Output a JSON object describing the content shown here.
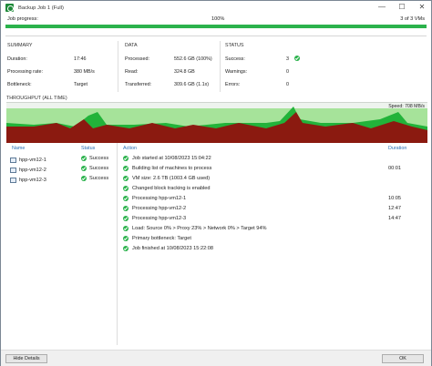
{
  "window": {
    "title": "Backup Job 1 (Full)",
    "controls": [
      "—",
      "☐",
      "✕"
    ]
  },
  "progress": {
    "label": "Job progress:",
    "percent_text": "100%",
    "count_text": "3 of 3 VMs",
    "fraction": 1.0,
    "color": "#2bb24c"
  },
  "summary": {
    "heading": "SUMMARY",
    "rows": [
      {
        "label": "Duration:",
        "value": "17:46"
      },
      {
        "label": "Processing rate:",
        "value": "380 MB/s"
      },
      {
        "label": "Bottleneck:",
        "value": "Target"
      }
    ]
  },
  "data": {
    "heading": "DATA",
    "rows": [
      {
        "label": "Processed:",
        "value": "552.6 GB (100%)"
      },
      {
        "label": "Read:",
        "value": "324.8 GB"
      },
      {
        "label": "Transferred:",
        "value": "309.6 GB (1.1x)"
      }
    ]
  },
  "status": {
    "heading": "STATUS",
    "rows": [
      {
        "label": "Success:",
        "value": "3"
      },
      {
        "label": "Warnings:",
        "value": "0"
      },
      {
        "label": "Errors:",
        "value": "0"
      }
    ]
  },
  "throughput": {
    "heading": "THROUGHPUT (ALL TIME)",
    "speed_text": "Speed: 708 MB/s",
    "colors": {
      "read": "#8b1a10",
      "transfer": "#22b33a",
      "bg": "#a6e39a"
    }
  },
  "vm_table": {
    "headers": {
      "name": "Name",
      "status": "Status"
    },
    "rows": [
      {
        "name": "hpp-vm12-1",
        "status": "Success"
      },
      {
        "name": "hpp-vm12-2",
        "status": "Success"
      },
      {
        "name": "hpp-vm12-3",
        "status": "Success"
      }
    ]
  },
  "action_table": {
    "headers": {
      "action": "Action",
      "duration": "Duration"
    },
    "rows": [
      {
        "text": "Job started at 10/08/2023 15:04:22",
        "duration": ""
      },
      {
        "text": "Building list of machines to process",
        "duration": "00:01"
      },
      {
        "text": "VM size: 2.6 TB (1003.4 GB used)",
        "duration": ""
      },
      {
        "text": "Changed block tracking is enabled",
        "duration": ""
      },
      {
        "text": "Processing hpp-vm12-1",
        "duration": "10:05"
      },
      {
        "text": "Processing hpp-vm12-2",
        "duration": "12:47"
      },
      {
        "text": "Processing hpp-vm12-3",
        "duration": "14:47"
      },
      {
        "text": "Load: Source 0% > Proxy 23% > Network 0% > Target 94%",
        "duration": ""
      },
      {
        "text": "Primary bottleneck: Target",
        "duration": ""
      },
      {
        "text": "Job finished at 10/08/2023 15:22:08",
        "duration": ""
      }
    ]
  },
  "footer": {
    "hide_details_label": "Hide Details",
    "ok_label": "OK"
  }
}
